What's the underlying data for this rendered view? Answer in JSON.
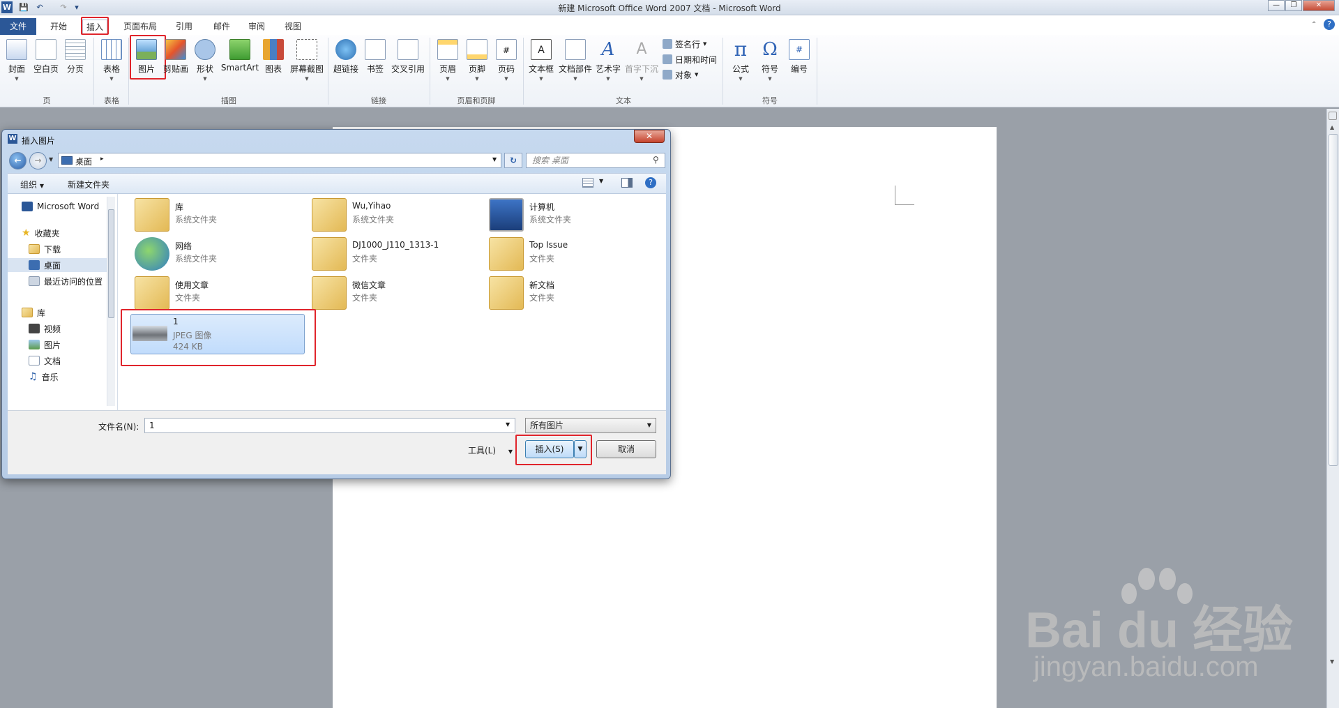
{
  "window": {
    "title": "新建 Microsoft Office Word 2007 文档 - Microsoft Word"
  },
  "tabs": [
    "文件",
    "开始",
    "插入",
    "页面布局",
    "引用",
    "邮件",
    "审阅",
    "视图"
  ],
  "ribbon": {
    "buttons": [
      "封面",
      "空白页",
      "分页",
      "表格",
      "图片",
      "剪贴画",
      "形状",
      "SmartArt",
      "图表",
      "屏幕截图",
      "超链接",
      "书签",
      "交叉引用",
      "页眉",
      "页脚",
      "页码",
      "文本框",
      "文档部件",
      "艺术字",
      "首字下沉",
      "公式",
      "符号",
      "编号"
    ],
    "small": [
      "签名行",
      "日期和时间",
      "对象"
    ],
    "groups": [
      "页",
      "表格",
      "插图",
      "链接",
      "页眉和页脚",
      "文本",
      "符号"
    ]
  },
  "dialog": {
    "title": "插入图片",
    "address": "桌面",
    "search_placeholder": "搜索 桌面",
    "organize": "组织",
    "new_folder": "新建文件夹",
    "nav": [
      "Microsoft Word",
      "收藏夹",
      "下载",
      "桌面",
      "最近访问的位置",
      "库",
      "视频",
      "图片",
      "文档",
      "音乐"
    ],
    "files": [
      {
        "name": "库",
        "type": "系统文件夹"
      },
      {
        "name": "Wu,Yihao",
        "type": "系统文件夹"
      },
      {
        "name": "计算机",
        "type": "系统文件夹"
      },
      {
        "name": "网络",
        "type": "系统文件夹"
      },
      {
        "name": "DJ1000_J110_1313-1",
        "type": "文件夹"
      },
      {
        "name": "Top Issue",
        "type": "文件夹"
      },
      {
        "name": "使用文章",
        "type": "文件夹"
      },
      {
        "name": "微信文章",
        "type": "文件夹"
      },
      {
        "name": "新文档",
        "type": "文件夹"
      },
      {
        "name": "1",
        "type": "JPEG 图像",
        "size": "424 KB"
      }
    ],
    "filename_label": "文件名(N):",
    "filename_value": "1",
    "filter": "所有图片",
    "tools": "工具(L)",
    "insert": "插入(S)",
    "cancel": "取消"
  },
  "watermark": {
    "brand": "Bai du 经验",
    "url": "jingyan.baidu.com"
  }
}
